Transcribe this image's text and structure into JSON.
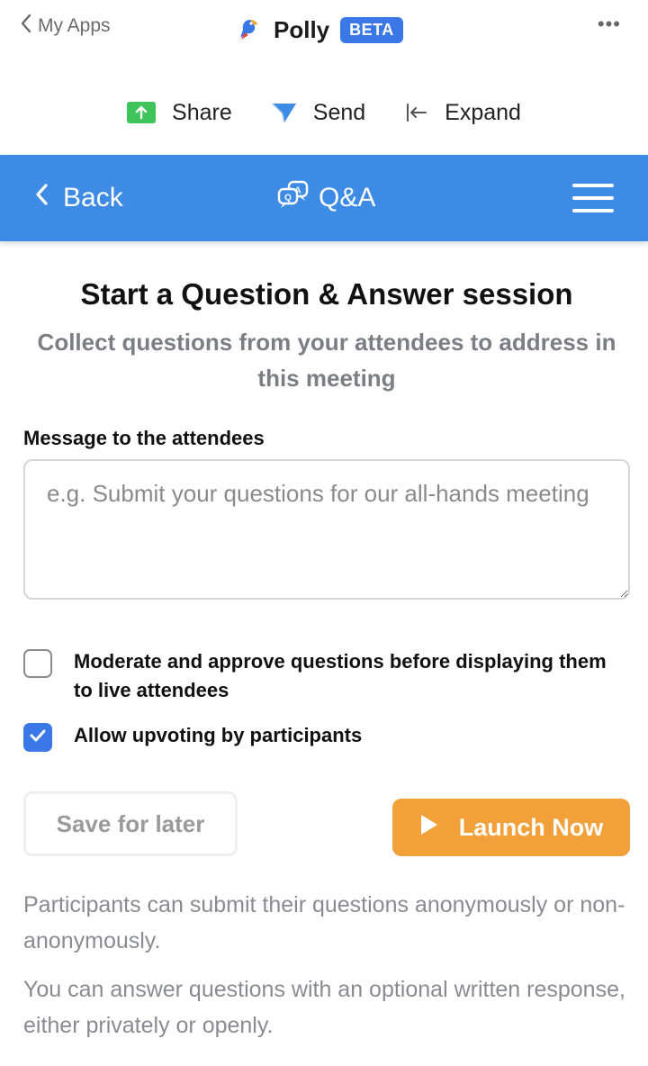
{
  "topbar": {
    "back_label": "My Apps",
    "app_name": "Polly",
    "badge": "BETA",
    "more": "•••"
  },
  "actions": [
    {
      "label": "Share",
      "icon": "share-upload-icon"
    },
    {
      "label": "Send",
      "icon": "send-paper-plane-icon"
    },
    {
      "label": "Expand",
      "icon": "expand-arrow-icon"
    }
  ],
  "nav": {
    "back_label": "Back",
    "title": "Q&A",
    "title_icon": "qa-chat-bubbles-icon",
    "menu_icon": "hamburger-menu-icon"
  },
  "main": {
    "heading": "Start a Question & Answer session",
    "subheading": "Collect questions from your attendees to address in this meeting",
    "message_label": "Message to the attendees",
    "message_placeholder": "e.g. Submit your questions for our all-hands meeting",
    "message_value": "",
    "options": [
      {
        "label": "Moderate and approve questions before displaying them to live attendees",
        "checked": false
      },
      {
        "label": "Allow upvoting by participants",
        "checked": true
      }
    ],
    "save_button": "Save for later",
    "launch_button": "Launch Now",
    "notes": [
      "Participants can submit their questions anonymously or non-anonymously.",
      "You can answer questions with an optional written response, either privately or openly."
    ]
  },
  "colors": {
    "brand_blue": "#3e8be6",
    "badge_blue": "#3b78e7",
    "launch_orange": "#f2a03a",
    "share_green": "#3fc35b"
  }
}
